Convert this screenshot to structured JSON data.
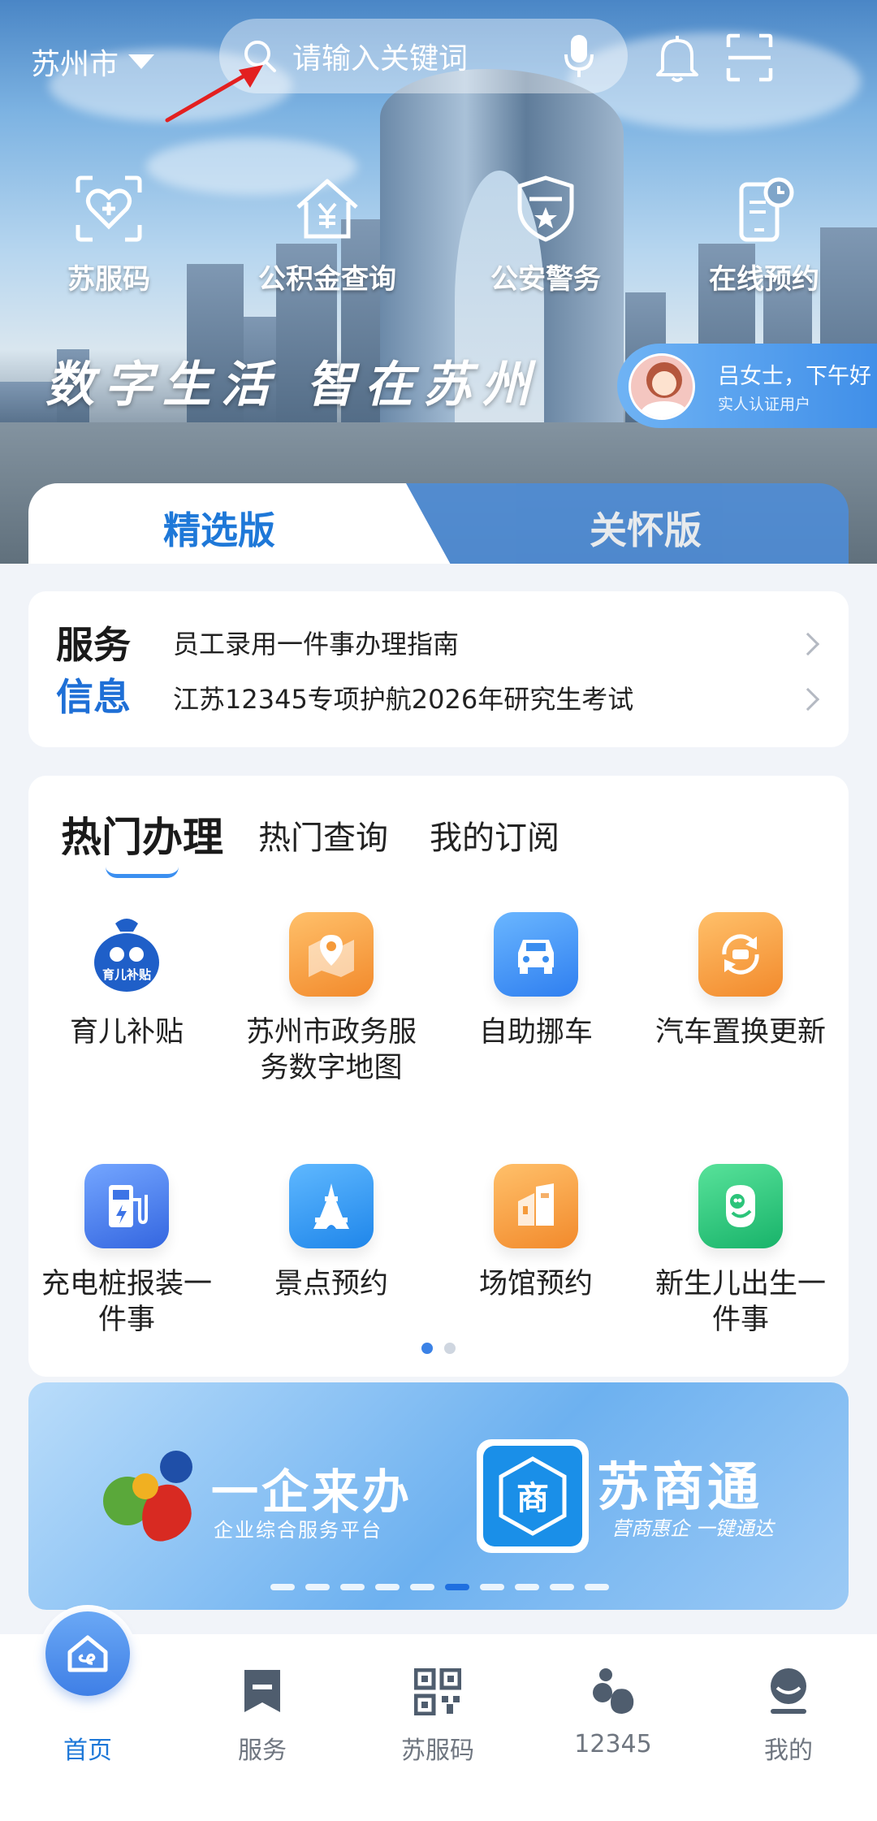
{
  "header": {
    "city": "苏州市",
    "search_placeholder": "请输入关键词"
  },
  "quick_actions": [
    {
      "label": "苏服码",
      "icon": "heart-shield-icon"
    },
    {
      "label": "公积金查询",
      "icon": "house-yuan-icon"
    },
    {
      "label": "公安警务",
      "icon": "police-badge-icon"
    },
    {
      "label": "在线预约",
      "icon": "phone-clock-icon"
    }
  ],
  "slogan": "数字生活 智在苏州",
  "user": {
    "greeting": "吕女士，下午好",
    "status": "实人认证用户"
  },
  "edition_tabs": {
    "selected": "精选版",
    "other": "关怀版"
  },
  "service_info": {
    "badge_line1": "服务",
    "badge_line2": "信息",
    "items": [
      "员工录用一件事办理指南",
      "江苏12345专项护航2026年研究生考试"
    ]
  },
  "hot": {
    "tabs": [
      "热门办理",
      "热门查询",
      "我的订阅"
    ],
    "active_tab": 0,
    "services": [
      {
        "label": "育儿补贴",
        "icon": "childcare-subsidy-icon",
        "color": "#1f6fe0"
      },
      {
        "label": "苏州市政务服务数字地图",
        "icon": "map-pin-icon",
        "color": "#f59a3a"
      },
      {
        "label": "自助挪车",
        "icon": "car-icon",
        "color": "#3a8ef0"
      },
      {
        "label": "汽车置换更新",
        "icon": "car-refresh-icon",
        "color": "#f59a3a"
      },
      {
        "label": "充电桩报装一件事",
        "icon": "charging-pile-icon",
        "color": "#3d74e6"
      },
      {
        "label": "景点预约",
        "icon": "tower-icon",
        "color": "#2b8ef0"
      },
      {
        "label": "场馆预约",
        "icon": "building-icon",
        "color": "#f59a3a"
      },
      {
        "label": "新生儿出生一件事",
        "icon": "baby-icon",
        "color": "#2cc47a"
      }
    ],
    "page_dots": 2,
    "page_active": 0
  },
  "banner": {
    "left_title": "一企来办",
    "left_sub": "企业综合服务平台",
    "right_title": "苏商通",
    "right_sub": "营商惠企 一键通达",
    "logo_char": "商",
    "dots": 10,
    "active_dot": 5
  },
  "bottom_nav": [
    {
      "label": "首页",
      "icon": "home-icon",
      "active": true
    },
    {
      "label": "服务",
      "icon": "flag-icon",
      "active": false
    },
    {
      "label": "苏服码",
      "icon": "qr-code-icon",
      "active": false
    },
    {
      "label": "12345",
      "icon": "hotline-icon",
      "active": false
    },
    {
      "label": "我的",
      "icon": "profile-icon",
      "active": false
    }
  ]
}
